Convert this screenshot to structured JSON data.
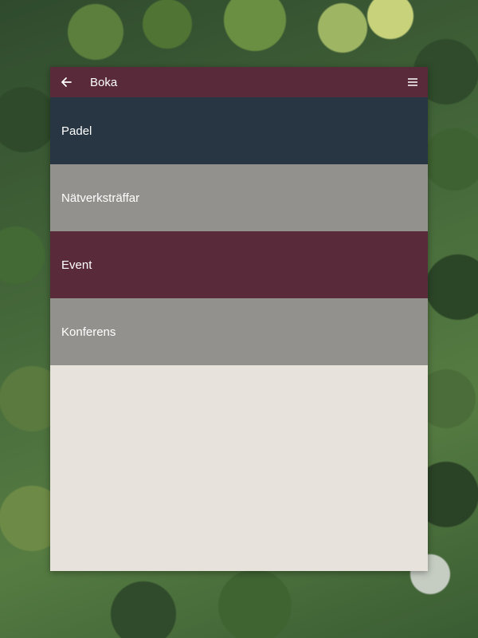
{
  "app_bar": {
    "title": "Boka",
    "back_icon": "arrow-left-icon",
    "menu_icon": "hamburger-menu-icon",
    "color": "#582a3a"
  },
  "menu_items": [
    {
      "label": "Padel",
      "color": "#273642"
    },
    {
      "label": "Nätverksträffar",
      "color": "#93918d"
    },
    {
      "label": "Event",
      "color": "#582a3a"
    },
    {
      "label": "Konferens",
      "color": "#93918d"
    }
  ],
  "panel_background": "#e8e2dd"
}
